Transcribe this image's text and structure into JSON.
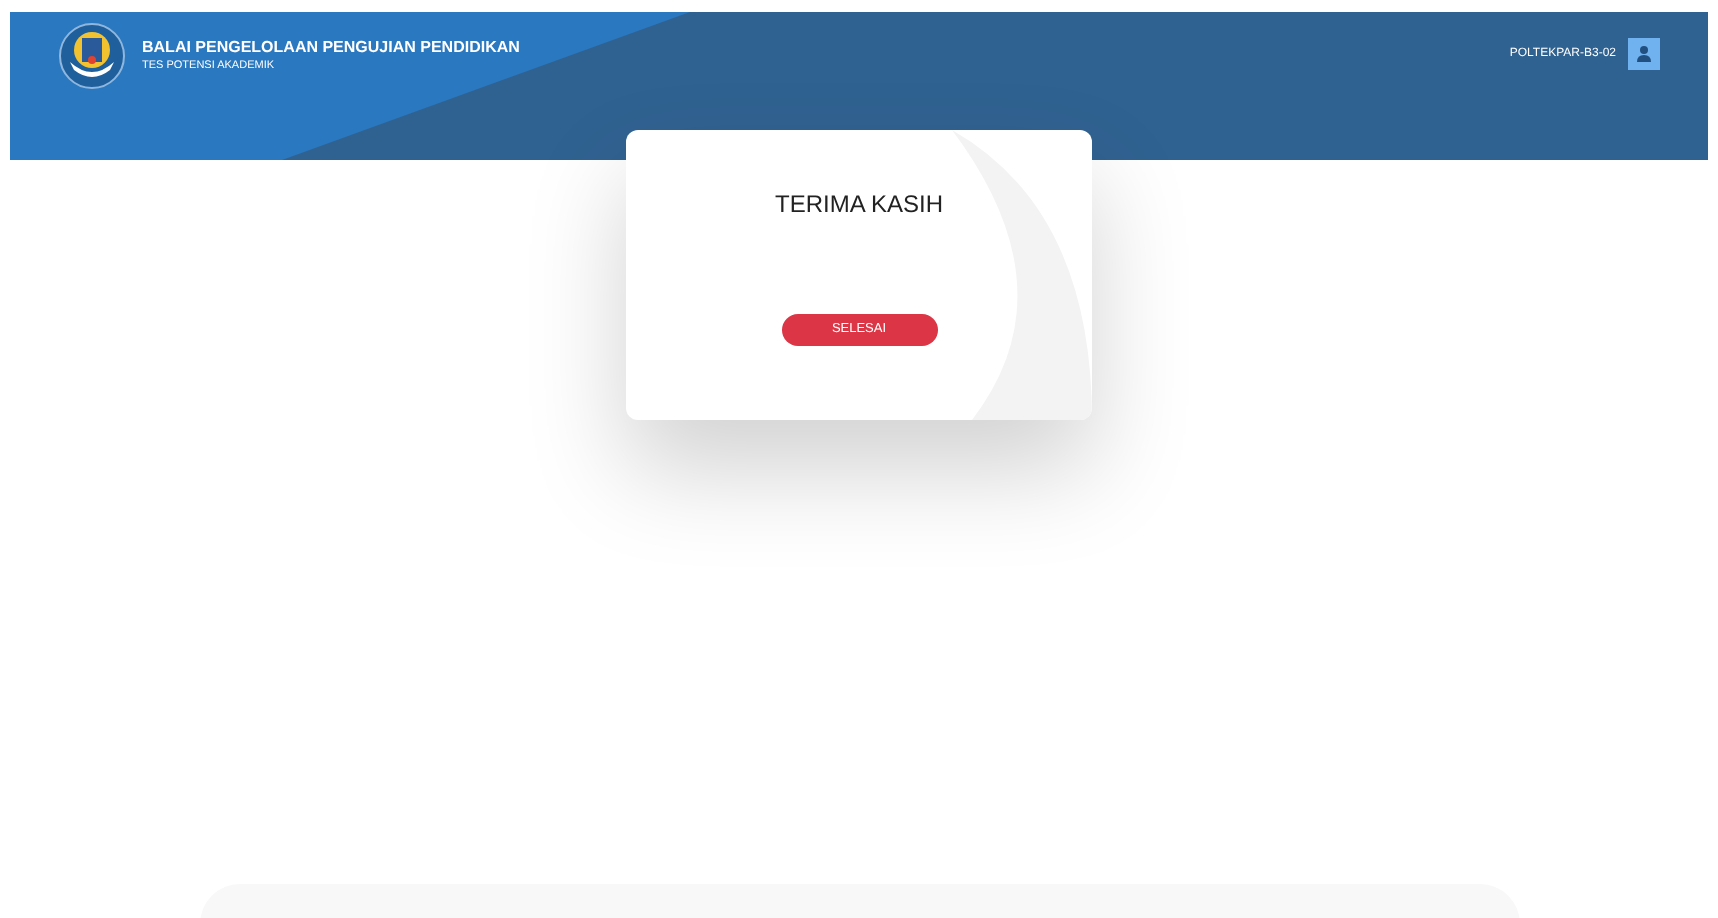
{
  "header": {
    "title": "BALAI PENGELOLAAN PENGUJIAN PENDIDIKAN",
    "subtitle": "TES POTENSI AKADEMIK",
    "user": "POLTEKPAR-B3-02"
  },
  "dialog": {
    "title": "TERIMA KASIH",
    "button": "SELESAI"
  }
}
